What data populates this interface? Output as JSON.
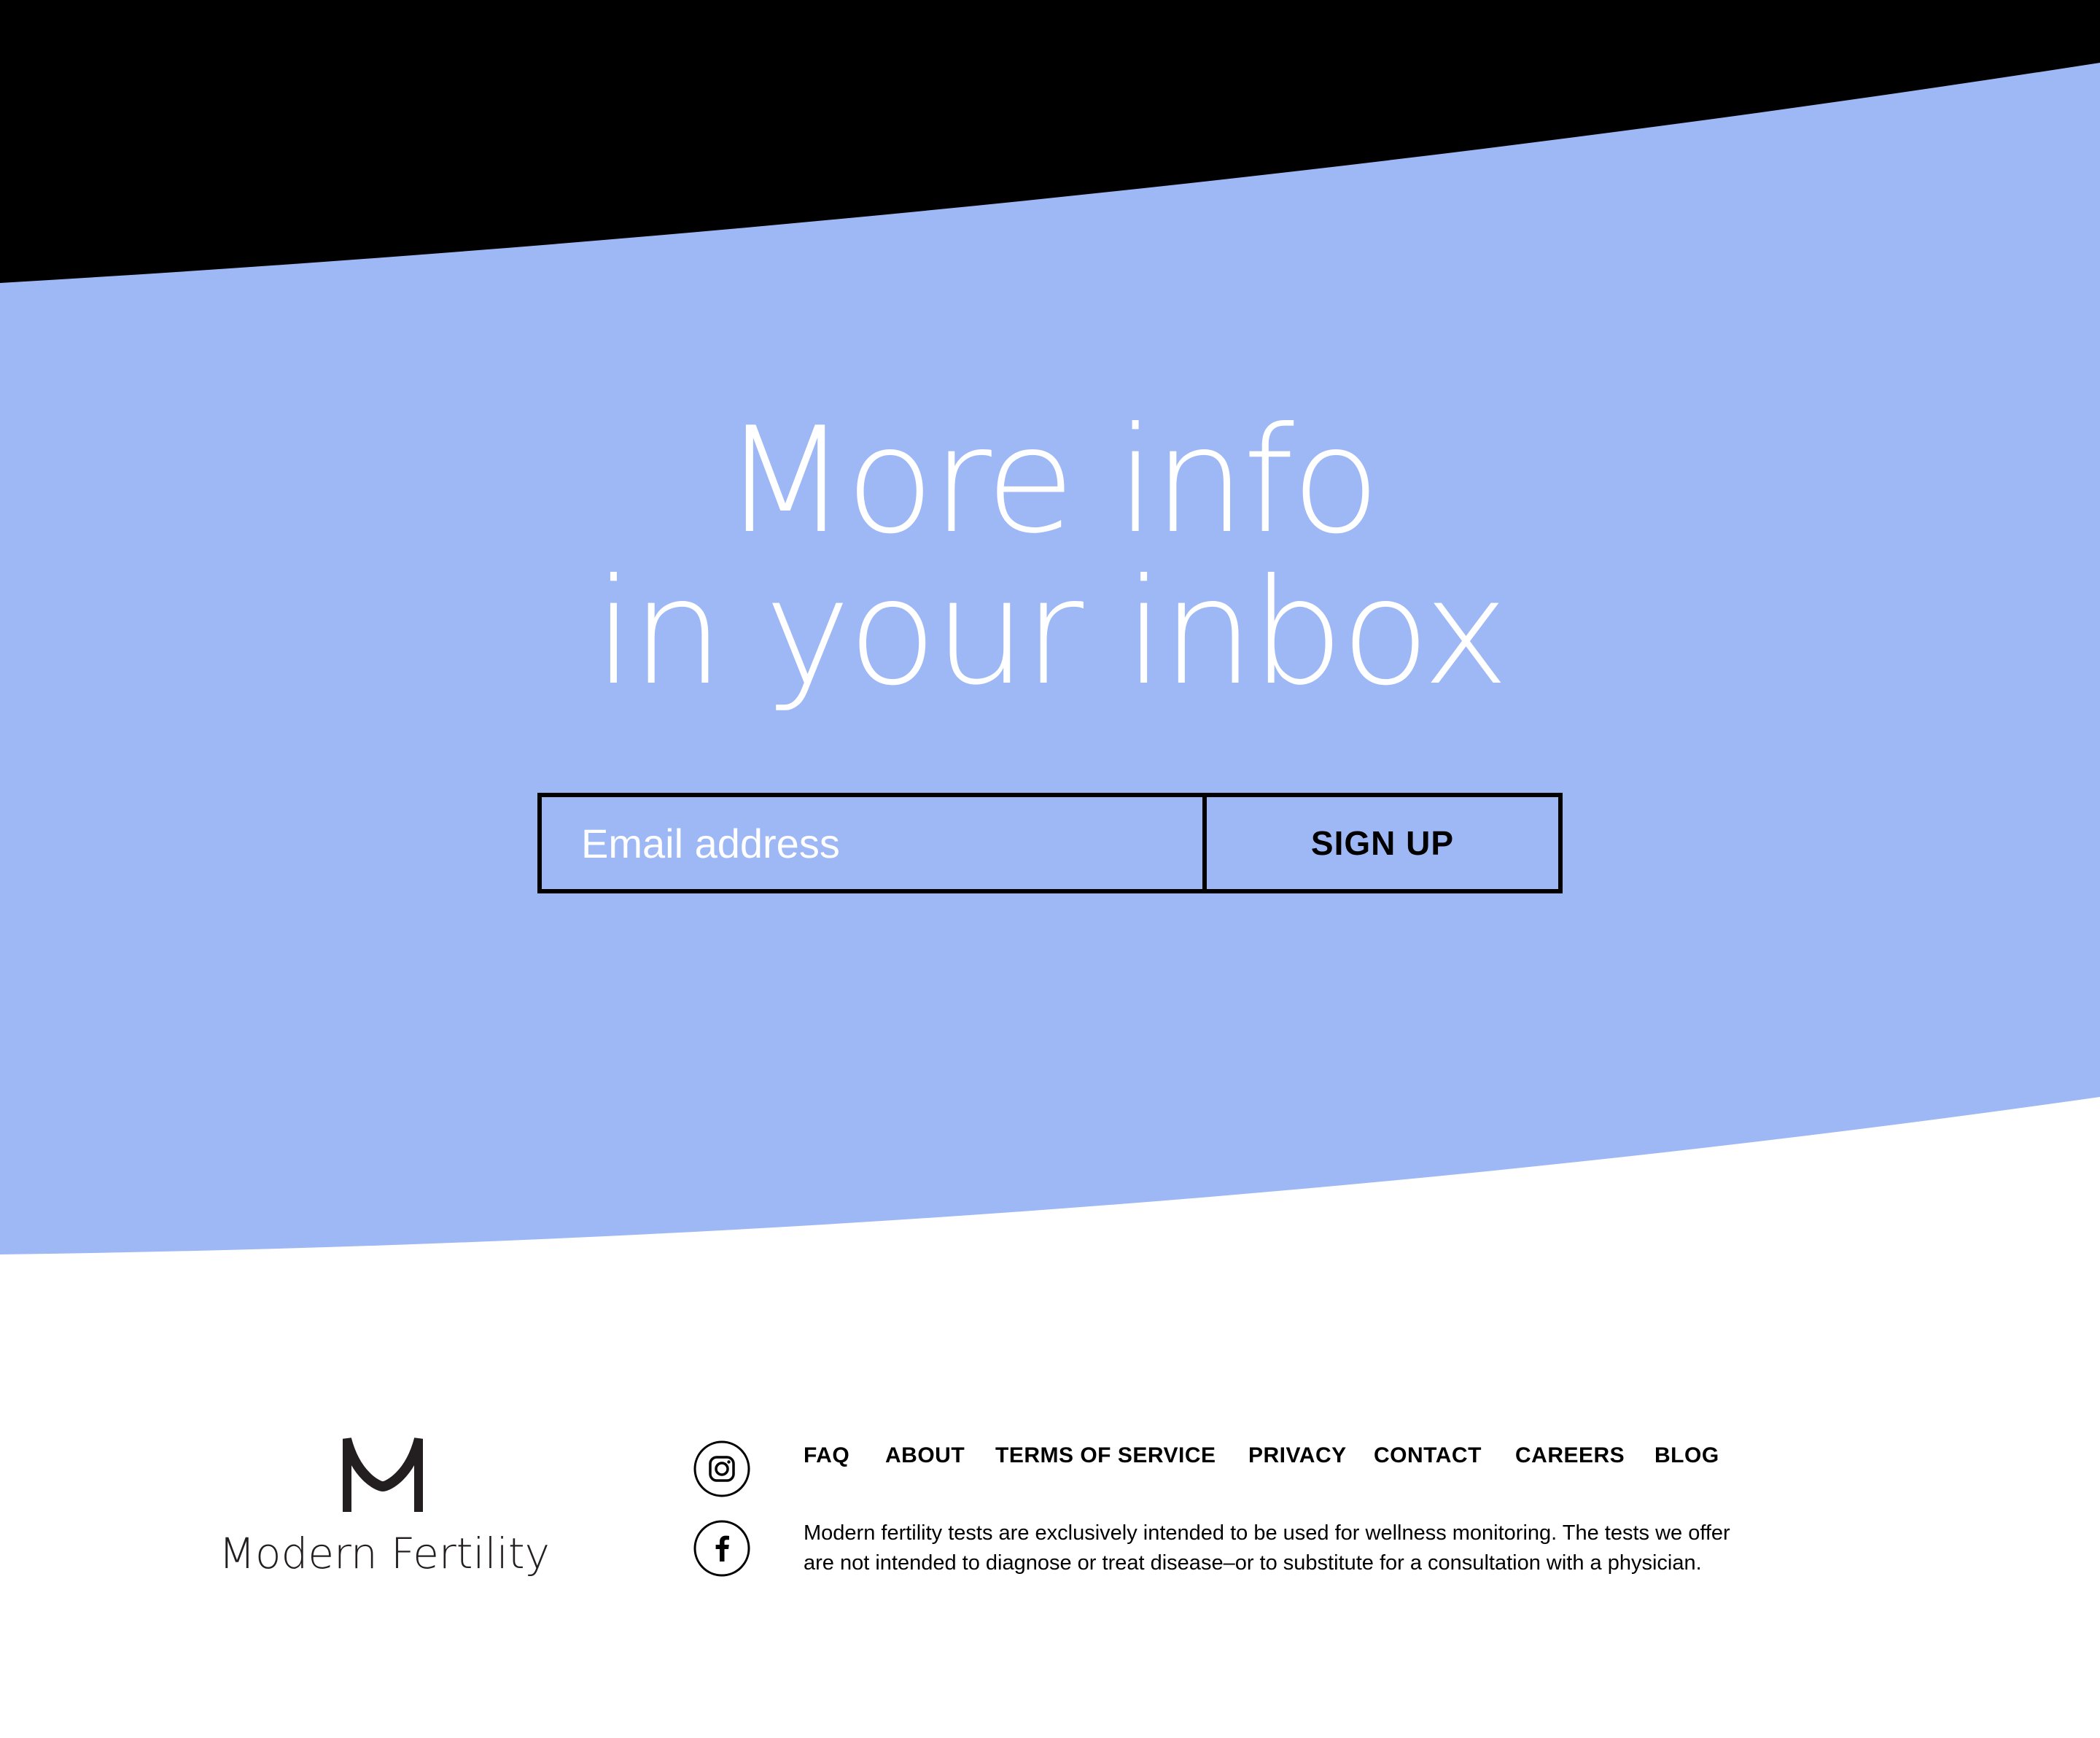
{
  "colors": {
    "hero_background": "#9db8f4",
    "top_band": "#000000",
    "page_background": "#ffffff",
    "headline_text": "#ffffff",
    "button_text": "#000000",
    "logo": "#231f20"
  },
  "hero": {
    "headline_line1": "More info",
    "headline_line2": "in your inbox"
  },
  "signup": {
    "email_placeholder": "Email address",
    "email_value": "",
    "button_label": "SIGN UP"
  },
  "brand": {
    "name": "Modern Fertility",
    "logo_icon": "modern-fertility-m-logo"
  },
  "social": [
    {
      "icon": "instagram-icon"
    },
    {
      "icon": "facebook-icon"
    }
  ],
  "footer": {
    "nav": [
      "FAQ",
      "ABOUT",
      "TERMS OF SERVICE",
      "PRIVACY",
      "CONTACT",
      "CAREERS",
      "BLOG"
    ],
    "disclaimer_line1": "Modern fertility tests are exclusively intended to be used for wellness monitoring. The tests we offer",
    "disclaimer_line2": "are not intended to diagnose or treat disease–or to substitute for a consultation with a physician."
  }
}
